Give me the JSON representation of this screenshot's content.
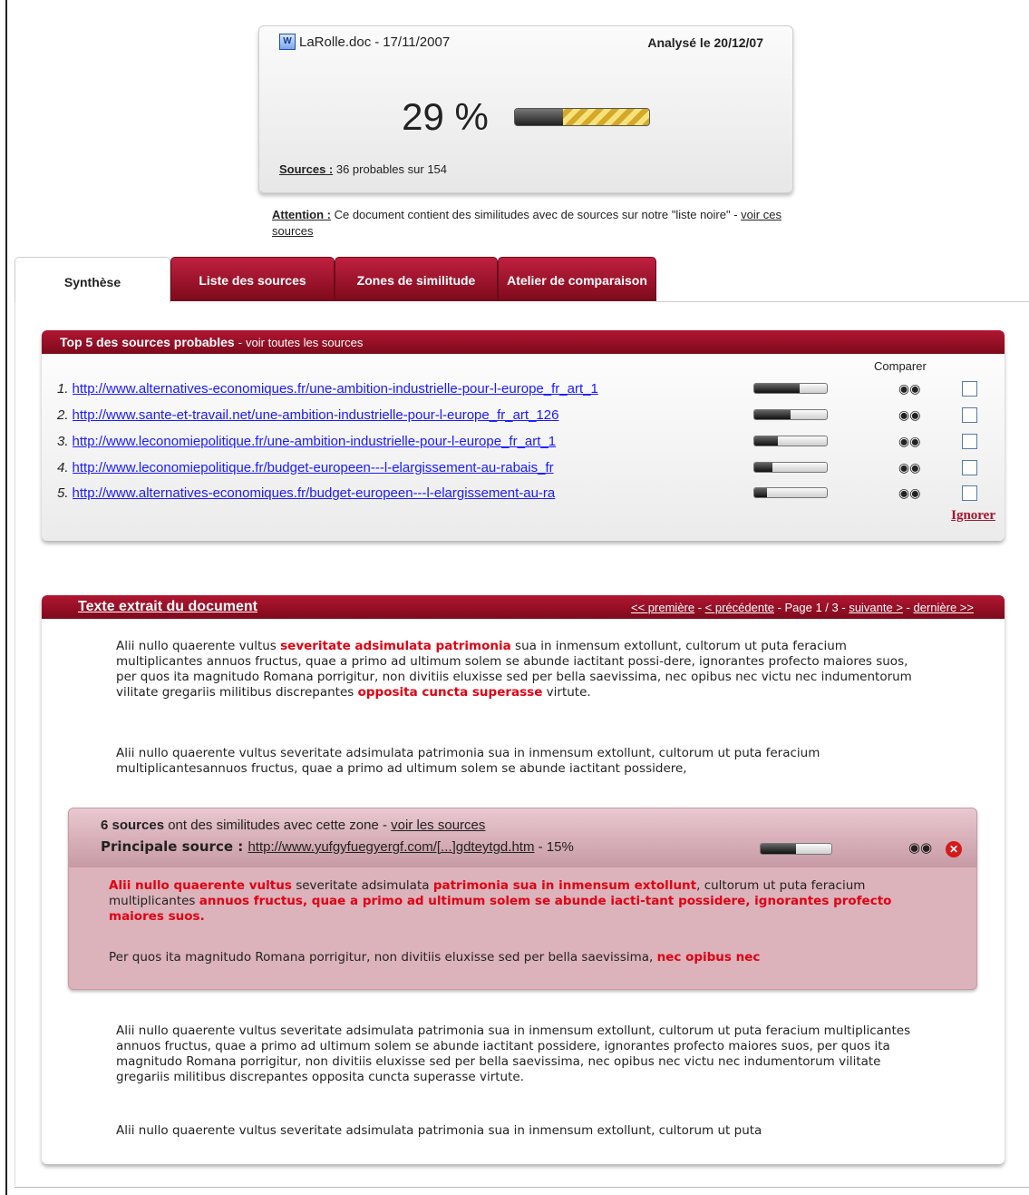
{
  "document": {
    "name": "LaRolle.doc",
    "date_sep": " - ",
    "date": "17/11/2007",
    "analysed": "Analysé le 20/12/07",
    "icon": "word-doc-icon",
    "percent": "29 %",
    "progress_fraction": 0.29,
    "sources_label": "Sources :",
    "sources_text": " 36 probables sur 154"
  },
  "warning": {
    "label": "Attention :",
    "text": " Ce document contient des similitudes avec de sources sur notre \"liste noire\" - ",
    "link": "voir ces sources"
  },
  "tabs": [
    {
      "label": "Synthèse",
      "active": true
    },
    {
      "label": "Liste des sources",
      "active": false
    },
    {
      "label": "Zones de similitude",
      "active": false
    },
    {
      "label": "Atelier de comparaison",
      "active": false
    }
  ],
  "top5": {
    "title": "Top 5 des sources probables",
    "sep": " - ",
    "link": "voir toutes les sources",
    "compare_label": "Comparer",
    "ignore_label": "Ignorer",
    "rows": [
      {
        "num": "1.",
        "url": "http://www.alternatives-economiques.fr/une-ambition-industrielle-pour-l-europe_fr_art_1",
        "level": 0.62
      },
      {
        "num": "2.",
        "url": "http://www.sante-et-travail.net/une-ambition-industrielle-pour-l-europe_fr_art_126",
        "level": 0.5
      },
      {
        "num": "3.",
        "url": "http://www.leconomiepolitique.fr/une-ambition-industrielle-pour-l-europe_fr_art_1",
        "level": 0.32
      },
      {
        "num": "4.",
        "url": "http://www.leconomiepolitique.fr/budget-europeen---l-elargissement-au-rabais_fr",
        "level": 0.25
      },
      {
        "num": "5.",
        "url": "http://www.alternatives-economiques.fr/budget-europeen---l-elargissement-au-ra",
        "level": 0.18
      }
    ]
  },
  "text_panel": {
    "title": "Texte extrait du document",
    "pager": {
      "first": "<< première",
      "sep1": " - ",
      "prev": "< précédente",
      "page": " - Page 1 / 3 - ",
      "next": "suivante >",
      "sep2": " - ",
      "last": "dernière >>"
    },
    "para1": {
      "a": "Alii nullo quaerente vultus ",
      "b": "severitate adsimulata patrimonia",
      "c": " sua in inmensum extollunt, cultorum ut puta feracium multiplicantes annuos fructus, quae a primo ad ultimum solem se abunde iactitant possi-dere, ignorantes profecto maiores suos, per quos ita magnitudo Romana porrigitur, non divitiis eluxisse sed per bella saevissima, nec opibus nec victu nec indumentorum vilitate gregariis militibus discrepantes ",
      "d": "opposita cuncta superasse",
      "e": " virtute."
    },
    "para2": "Alii nullo quaerente vultus severitate adsimulata patrimonia sua in inmensum extollunt, cultorum ut puta feracium multiplicantesannuos fructus, quae a primo ad ultimum solem se abunde iactitant possidere,",
    "similarity": {
      "count": "6 sources",
      "count_text": " ont des similitudes avec cette zone - ",
      "link": "voir les sources",
      "main_label": "Principale source : ",
      "main_url": "http://www.yufgyfuegyergf.com/[...]gdteytgd.htm",
      "main_pct": " - 15%",
      "level": 0.5,
      "para1": {
        "a": "Alii nullo quaerente vultus",
        "b": " severitate adsimulata ",
        "c": "patrimonia sua in inmensum extollunt",
        "d": ", cultorum ut puta feracium multiplicantes ",
        "e": "annuos fructus, quae a primo ad ultimum solem se abunde iacti-tant possidere, ignorantes profecto maiores suos."
      },
      "para2": {
        "a": "Per quos ita magnitudo Romana porrigitur, non divitiis eluxisse sed per bella saevissima, ",
        "b": "nec opibus nec"
      }
    },
    "para3": "Alii nullo quaerente vultus severitate adsimulata patrimonia sua in inmensum extollunt, cultorum ut puta feracium multiplicantes annuos fructus, quae a primo ad ultimum solem se abunde iactitant possidere, ignorantes profecto maiores suos, per quos ita magnitudo Romana porrigitur, non divitiis eluxisse sed per bella saevissima, nec opibus nec victu nec indumentorum vilitate gregariis militibus discrepantes opposita cuncta superasse virtute.",
    "para4": "Alii nullo quaerente vultus severitate adsimulata patrimonia sua in inmensum extollunt, cultorum ut puta"
  }
}
